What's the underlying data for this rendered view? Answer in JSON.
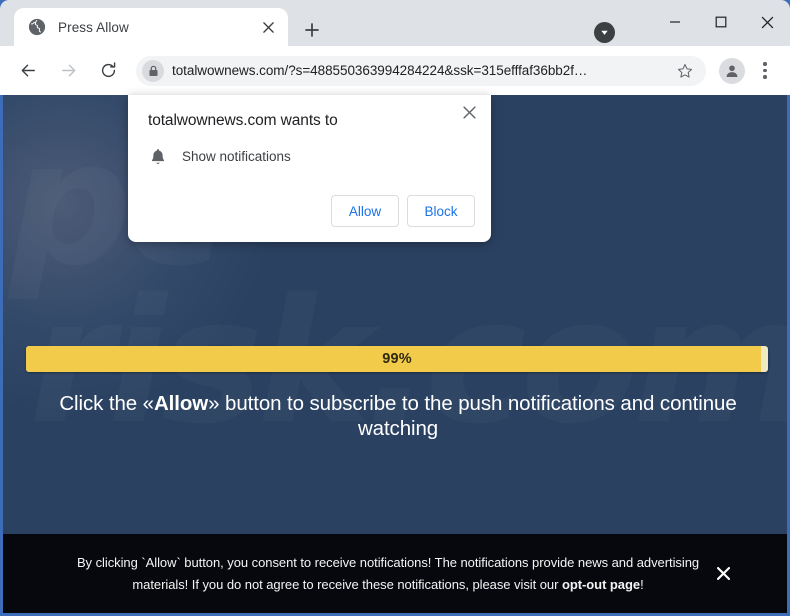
{
  "window": {
    "minimize_label": "minimize",
    "maximize_label": "maximize",
    "close_label": "close"
  },
  "tab": {
    "title": "Press Allow",
    "favicon": "globe-icon",
    "close_label": "×",
    "newtab_label": "+"
  },
  "toolbar": {
    "back_label": "back",
    "forward_label": "forward",
    "reload_label": "reload",
    "url": "totalwownews.com/?s=488550363994284224&ssk=315efffaf36bb2f…",
    "lock_icon": "lock-icon",
    "bookmark_icon": "star-icon",
    "profile_icon": "person-icon",
    "menu_icon": "three-dot-menu-icon"
  },
  "notification_dialog": {
    "title": "totalwownews.com wants to",
    "permission_icon": "bell-icon",
    "permission_label": "Show notifications",
    "allow_label": "Allow",
    "block_label": "Block",
    "close_label": "✕"
  },
  "page": {
    "progress": {
      "percent_label": "99%",
      "percent_value": 99,
      "fill_color": "#f3cb4b",
      "track_color": "#efeac0"
    },
    "headline_prefix": "Click the «",
    "headline_bold": "Allow",
    "headline_suffix": "» button to subscribe to the push notifications and continue watching",
    "watermark_line1": "pc",
    "watermark_line2": "risk.com",
    "background_color": "#2a4161"
  },
  "consent_banner": {
    "line1": "By clicking `Allow` button, you consent to receive notifications! The notifications provide news and",
    "line2_prefix": "advertising materials! If you do not agree to receive these notifications, please visit our ",
    "line2_link": "opt-out page",
    "line2_suffix": "!",
    "close_label": "✕",
    "background_color": "#07080e"
  }
}
